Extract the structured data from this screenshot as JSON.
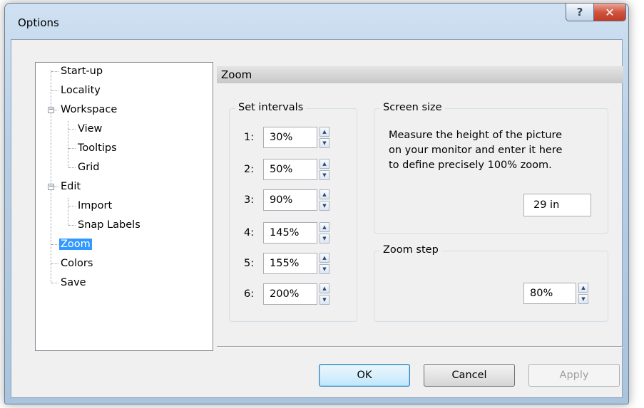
{
  "window": {
    "title": "Options",
    "help_label": "?",
    "close_label": "✕"
  },
  "tree": {
    "items": [
      {
        "label": "Start-up"
      },
      {
        "label": "Locality"
      },
      {
        "label": "Workspace",
        "expander": "−"
      },
      {
        "label": "View"
      },
      {
        "label": "Tooltips"
      },
      {
        "label": "Grid"
      },
      {
        "label": "Edit",
        "expander": "−"
      },
      {
        "label": "Import"
      },
      {
        "label": "Snap Labels"
      },
      {
        "label": "Zoom",
        "selected": true
      },
      {
        "label": "Colors"
      },
      {
        "label": "Save"
      }
    ]
  },
  "panel": {
    "title": "Zoom",
    "intervals": {
      "label": "Set intervals",
      "rows": [
        {
          "index": "1:",
          "value": "30%"
        },
        {
          "index": "2:",
          "value": "50%"
        },
        {
          "index": "3:",
          "value": "90%"
        },
        {
          "index": "4:",
          "value": "145%"
        },
        {
          "index": "5:",
          "value": "155%"
        },
        {
          "index": "6:",
          "value": "200%"
        }
      ]
    },
    "screen_size": {
      "label": "Screen size",
      "description_lines": [
        "Measure the height of the picture",
        "on your monitor and enter it here",
        "to define precisely 100% zoom."
      ],
      "value": "29 in"
    },
    "zoom_step": {
      "label": "Zoom step",
      "value": "80%"
    }
  },
  "buttons": {
    "ok": "OK",
    "cancel": "Cancel",
    "apply": "Apply"
  },
  "icons": {
    "spin_up": "▲",
    "spin_down": "▼"
  }
}
